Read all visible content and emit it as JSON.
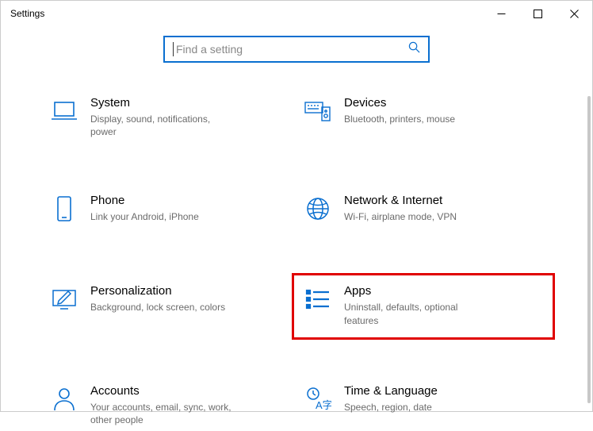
{
  "window": {
    "title": "Settings"
  },
  "search": {
    "placeholder": "Find a setting"
  },
  "categories": [
    {
      "id": "system",
      "title": "System",
      "desc": "Display, sound, notifications, power"
    },
    {
      "id": "devices",
      "title": "Devices",
      "desc": "Bluetooth, printers, mouse"
    },
    {
      "id": "phone",
      "title": "Phone",
      "desc": "Link your Android, iPhone"
    },
    {
      "id": "network",
      "title": "Network & Internet",
      "desc": "Wi-Fi, airplane mode, VPN"
    },
    {
      "id": "personalization",
      "title": "Personalization",
      "desc": "Background, lock screen, colors"
    },
    {
      "id": "apps",
      "title": "Apps",
      "desc": "Uninstall, defaults, optional features",
      "highlight": true
    },
    {
      "id": "accounts",
      "title": "Accounts",
      "desc": "Your accounts, email, sync, work, other people"
    },
    {
      "id": "time",
      "title": "Time & Language",
      "desc": "Speech, region, date"
    }
  ],
  "colors": {
    "accent": "#0a6fd0",
    "highlight_border": "#e00000"
  }
}
